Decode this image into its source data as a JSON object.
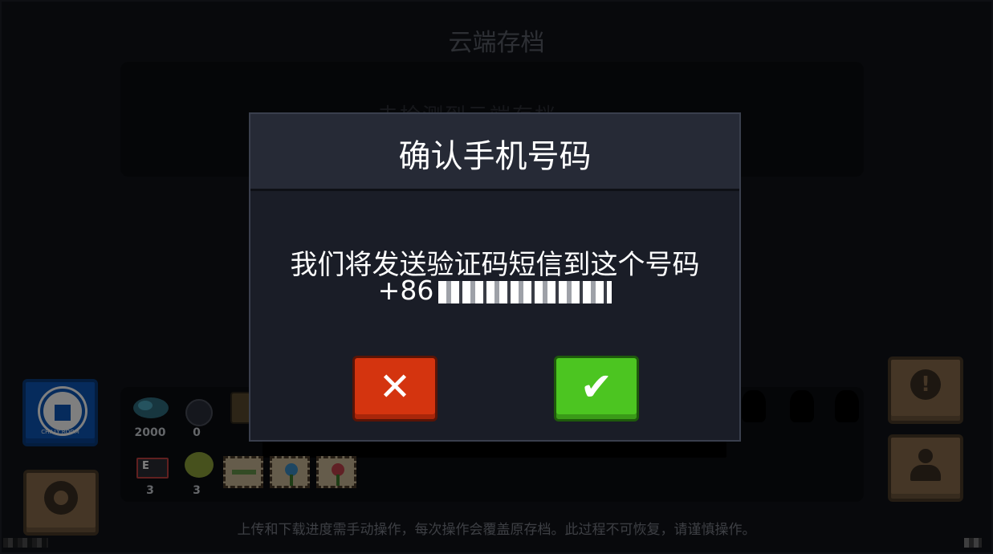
{
  "screen": {
    "title": "云端存档",
    "obscured_panel_text": "未检测到云端存档",
    "footer_note": "上传和下载进度需手动操作，每次操作会覆盖原存档。此过程不可恢复，请谨慎操作。"
  },
  "resources": {
    "coins": "2000",
    "gems": "0",
    "cards": "3",
    "seeds": "3"
  },
  "side_buttons": {
    "logo_text": "CHILLY ROOM",
    "warning_glyph": "!"
  },
  "dialog": {
    "title": "确认手机号码",
    "message": "我们将发送验证码短信到这个号码",
    "country_code": "+86",
    "cancel_glyph": "✕",
    "confirm_glyph": "✔"
  },
  "colors": {
    "cancel": "#d4340f",
    "confirm": "#4cc521",
    "dialog_bg": "#1a1d27",
    "dialog_header": "#262a36"
  },
  "icons": [
    "logo-icon",
    "gear-icon",
    "warning-icon",
    "user-icon",
    "coin-icon",
    "gem-icon",
    "chest-icon",
    "card-icon",
    "seed-icon",
    "close-icon",
    "check-icon"
  ]
}
